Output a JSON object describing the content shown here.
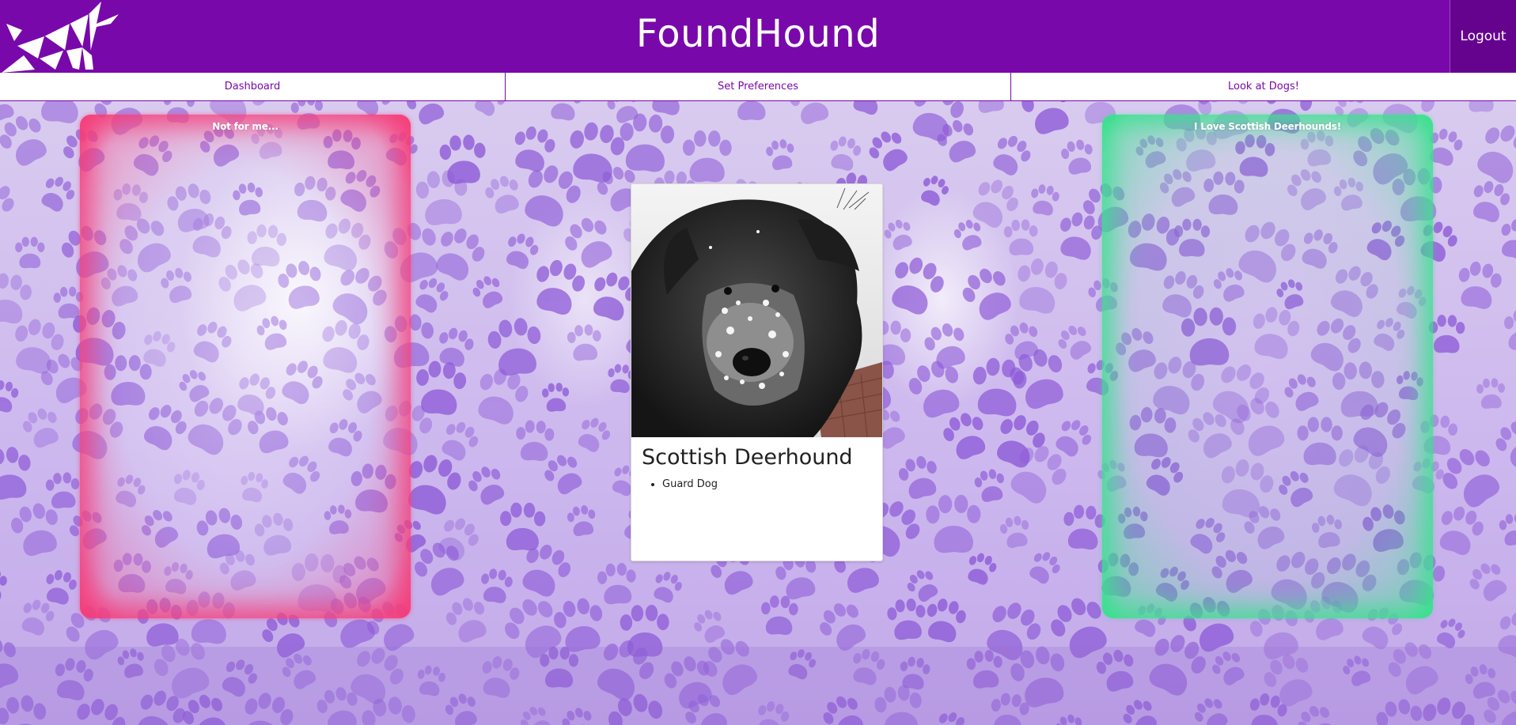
{
  "app": {
    "title": "FoundHound",
    "logout_label": "Logout",
    "logo_icon": "dog-logo-icon"
  },
  "nav": {
    "items": [
      {
        "label": "Dashboard"
      },
      {
        "label": "Set Preferences"
      },
      {
        "label": "Look at Dogs!"
      }
    ]
  },
  "swipe": {
    "reject_label": "Not for me...",
    "accept_label": "I Love Scottish Deerhounds!"
  },
  "dog": {
    "breed": "Scottish Deerhound",
    "traits": [
      "Guard Dog"
    ],
    "photo_icon": "dog-photo"
  },
  "colors": {
    "brand": "#7908aa",
    "logout_bg": "#65038f",
    "reject_glow": "#f53c78",
    "accept_glow": "#37e18c",
    "paw": "#8d5ad8"
  }
}
